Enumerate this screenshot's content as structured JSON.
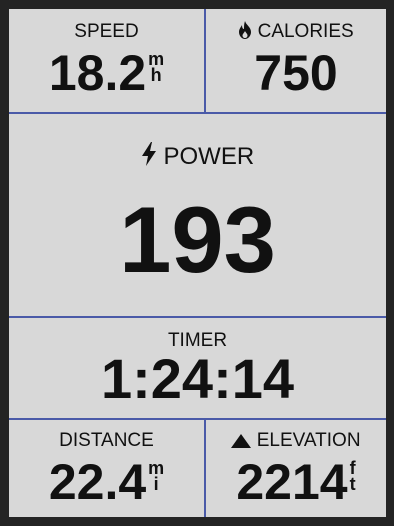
{
  "speed": {
    "label": "SPEED",
    "value": "18.2",
    "unit_top": "m",
    "unit_bottom": "h"
  },
  "calories": {
    "label": "CALORIES",
    "value": "750",
    "icon": "flame-icon"
  },
  "power": {
    "label": "POWER",
    "value": "193",
    "icon": "lightning-bolt-icon"
  },
  "timer": {
    "label": "TIMER",
    "value": "1:24:14"
  },
  "distance": {
    "label": "DISTANCE",
    "value": "22.4",
    "unit_top": "m",
    "unit_bottom": "i"
  },
  "elevation": {
    "label": "ELEVATION",
    "value": "2214",
    "unit_top": "f",
    "unit_bottom": "t",
    "icon": "mountain-icon"
  },
  "colors": {
    "background": "#d8d8d8",
    "divider": "#4a5aa8",
    "text": "#111111",
    "bezel": "#242424"
  }
}
